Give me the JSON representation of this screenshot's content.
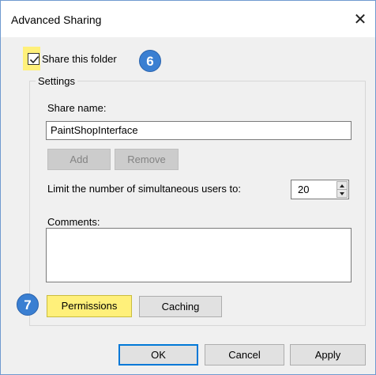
{
  "window": {
    "title": "Advanced Sharing",
    "close_glyph": "✕"
  },
  "share": {
    "label": "Share this folder",
    "checked": true
  },
  "badges": {
    "step6": "6",
    "step7": "7"
  },
  "settings": {
    "group_label": "Settings",
    "share_name_label": "Share name:",
    "share_name_value": "PaintShopInterface",
    "add_label": "Add",
    "remove_label": "Remove",
    "limit_label": "Limit the number of simultaneous users to:",
    "limit_value": "20",
    "comments_label": "Comments:",
    "comments_value": ""
  },
  "actions": {
    "permissions_label": "Permissions",
    "caching_label": "Caching"
  },
  "footer": {
    "ok_label": "OK",
    "cancel_label": "Cancel",
    "apply_label": "Apply"
  },
  "colors": {
    "highlight": "#fff07a",
    "badge": "#3a7fd2",
    "default_button_border": "#0078d7"
  },
  "icons": {
    "close": "close-icon",
    "check": "checkmark-icon",
    "spin_up": "chevron-up-icon",
    "spin_down": "chevron-down-icon"
  }
}
